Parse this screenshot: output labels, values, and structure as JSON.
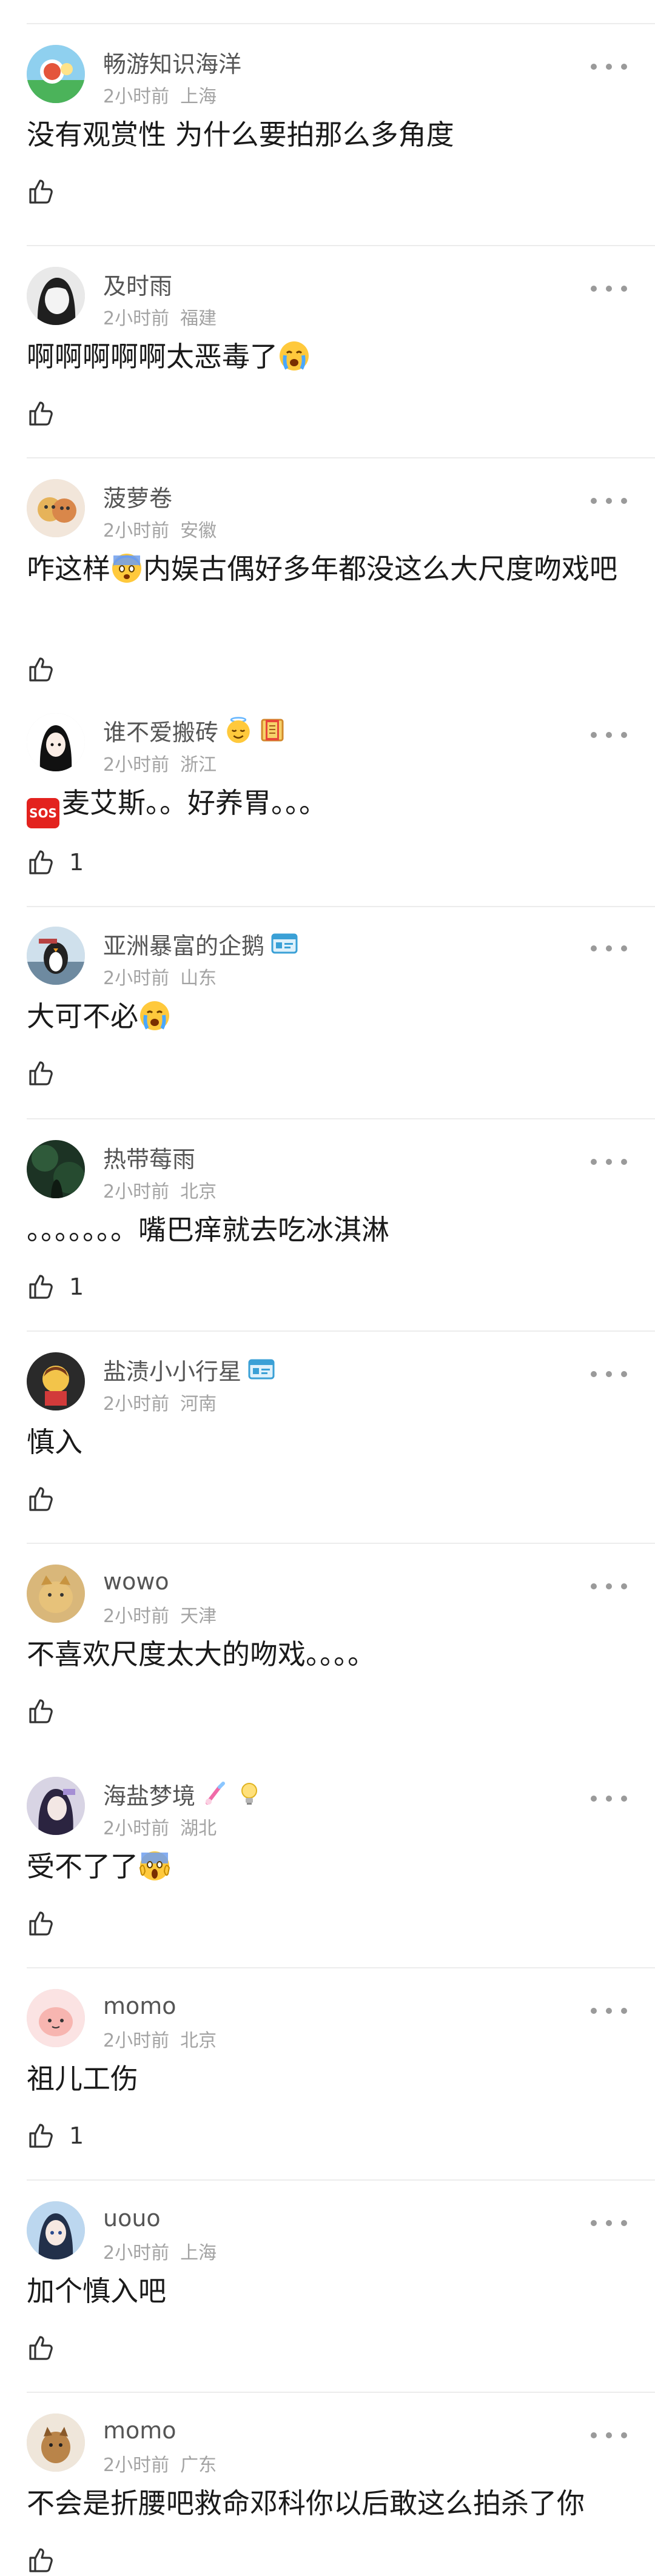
{
  "comments": [
    {
      "name": "畅游知识海洋",
      "time": "2小时前",
      "location": "上海",
      "text_a": "没有观赏性 为什么要拍那么多角度",
      "text_b": "",
      "likes": ""
    },
    {
      "name": "及时雨",
      "time": "2小时前",
      "location": "福建",
      "text_a": "啊啊啊啊啊太恶毒了",
      "text_b": "",
      "likes": ""
    },
    {
      "name": "菠萝卷",
      "time": "2小时前",
      "location": "安徽",
      "text_a": "咋这样",
      "text_b": "内娱古偶好多年都没这么大尺度吻戏吧",
      "likes": ""
    },
    {
      "name": "谁不爱搬砖",
      "time": "2小时前",
      "location": "浙江",
      "text_a": "麦艾斯。。好养胃。。。",
      "text_b": "",
      "likes": "1"
    },
    {
      "name": "亚洲暴富的企鹅",
      "time": "2小时前",
      "location": "山东",
      "text_a": "大可不必",
      "text_b": "",
      "likes": ""
    },
    {
      "name": "热带莓雨",
      "time": "2小时前",
      "location": "北京",
      "text_a": "。。。。。。。嘴巴痒就去吃冰淇淋",
      "text_b": "",
      "likes": "1"
    },
    {
      "name": "盐渍小小行星",
      "time": "2小时前",
      "location": "河南",
      "text_a": "慎入",
      "text_b": "",
      "likes": ""
    },
    {
      "name": "wowo",
      "time": "2小时前",
      "location": "天津",
      "text_a": "不喜欢尺度太大的吻戏。。。。",
      "text_b": "",
      "likes": ""
    },
    {
      "name": "海盐梦境",
      "time": "2小时前",
      "location": "湖北",
      "text_a": "受不了了",
      "text_b": "",
      "likes": ""
    },
    {
      "name": "momo",
      "time": "2小时前",
      "location": "北京",
      "text_a": "祖儿工伤",
      "text_b": "",
      "likes": "1"
    },
    {
      "name": "uouo",
      "time": "2小时前",
      "location": "上海",
      "text_a": "加个慎入吧",
      "text_b": "",
      "likes": ""
    },
    {
      "name": "momo",
      "time": "2小时前",
      "location": "广东",
      "text_a": "不会是折腰吧救命邓科你以后敢这么拍杀了你",
      "text_b": "",
      "likes": ""
    }
  ],
  "sos_label": "SOS",
  "icons": {
    "like": "thumbs-up-icon",
    "more": "more-dots-icon"
  }
}
